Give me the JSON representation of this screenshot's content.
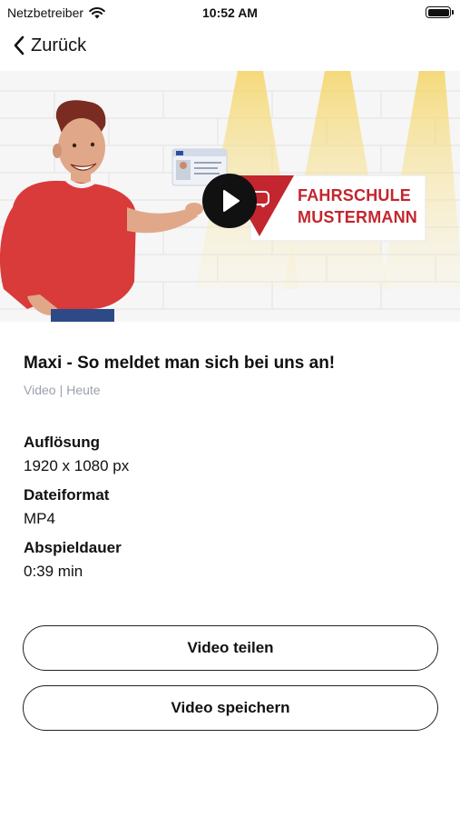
{
  "status_bar": {
    "carrier": "Netzbetreiber",
    "time": "10:52 AM"
  },
  "nav": {
    "back_label": "Zurück"
  },
  "hero": {
    "sign_line1": "FAHRSCHULE",
    "sign_line2": "MUSTERMANN",
    "license_card_title": "Führerschein",
    "brand_color": "#c3262e"
  },
  "video": {
    "title": "Maxi - So meldet man sich bei uns an!",
    "type": "Video",
    "separator": "|",
    "date": "Heute"
  },
  "details": [
    {
      "label": "Auflösung",
      "value": "1920 x 1080 px"
    },
    {
      "label": "Dateiformat",
      "value": "MP4"
    },
    {
      "label": "Abspieldauer",
      "value": "0:39 min"
    }
  ],
  "actions": {
    "share_label": "Video teilen",
    "save_label": "Video speichern"
  },
  "icons": {
    "wifi": "wifi-icon",
    "battery": "battery-icon",
    "back": "chevron-left-icon",
    "play": "play-icon"
  }
}
